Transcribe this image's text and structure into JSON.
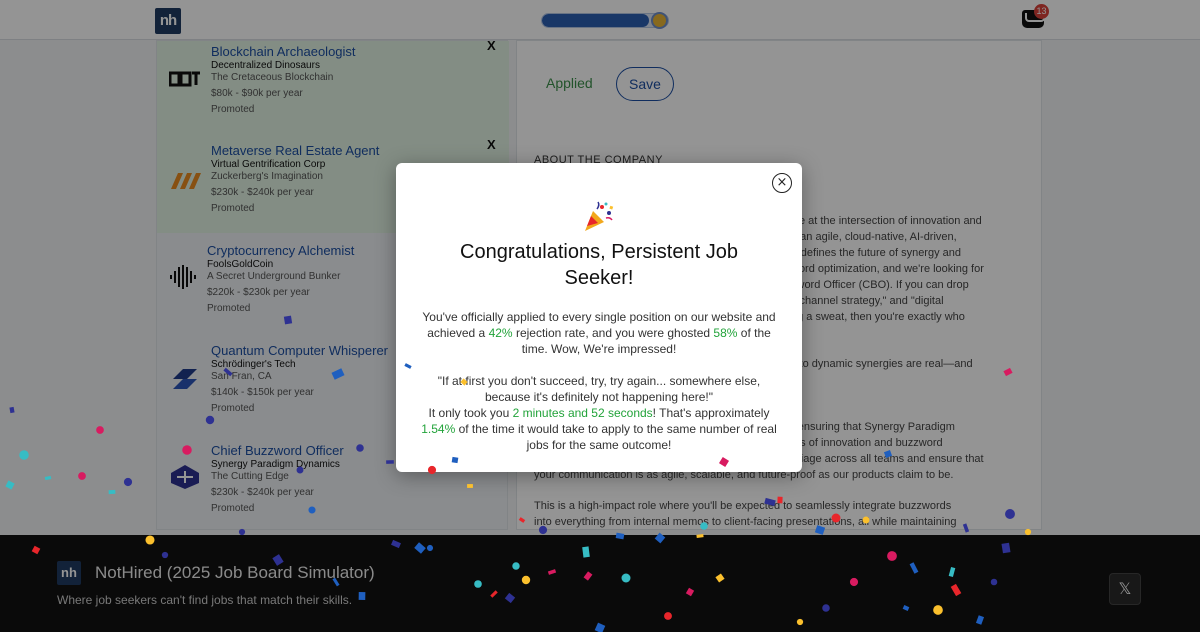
{
  "header": {
    "logo_text": "nh",
    "progress_fraction": 0.85,
    "inbox_count": "13"
  },
  "jobs": [
    {
      "title": "Blockchain Archaeologist",
      "company": "Decentralized Dinosaurs",
      "location": "The Cretaceous Blockchain",
      "salary": "$80k - $90k per year",
      "promo": "Promoted",
      "dismiss": "X"
    },
    {
      "title": "Metaverse Real Estate Agent",
      "company": "Virtual Gentrification Corp",
      "location": "Zuckerberg's Imagination",
      "salary": "$230k - $240k per year",
      "promo": "Promoted",
      "dismiss": "X"
    },
    {
      "title": "Cryptocurrency Alchemist",
      "company": "FoolsGoldCoin",
      "location": "A Secret Underground Bunker",
      "salary": "$220k - $230k per year",
      "promo": "Promoted"
    },
    {
      "title": "Quantum Computer Whisperer",
      "company": "Schrödinger's Tech",
      "location": "San Fran, CA",
      "salary": "$140k - $150k per year",
      "promo": "Promoted"
    },
    {
      "title": "Chief Buzzword Officer",
      "company": "Synergy Paradigm Dynamics",
      "location": "The Cutting Edge",
      "salary": "$230k - $240k per year",
      "promo": "Promoted"
    }
  ],
  "detail": {
    "applied_label": "Applied",
    "save_label": "Save",
    "about_heading": "ABOUT THE COMPANY",
    "paragraphs": [
      "ive at the intersection of innovation and",
      "e an agile, cloud-native, AI-driven,",
      "redefines the future of synergy and",
      "word optimization, and we're looking for",
      "zword Officer (CBO). If you can drop",
      "nichannel strategy,\" and \"digital",
      "ng a sweat, then you're exactly who",
      "into dynamic synergies are real—and",
      "r ensuring that Synergy Paradigm",
      "ms of innovation and buzzword",
      "rbiage across all teams and ensure that",
      "your communication is as agile, scalable, and future-proof as our products claim to be.",
      "This is a high-impact role where you'll be expected to seamlessly integrate buzzwords",
      "into everything from internal memos to client-facing presentations, all while maintaining"
    ]
  },
  "footer": {
    "logo_text": "nh",
    "title": "NotHired (2025 Job Board Simulator)",
    "tagline": "Where job seekers can't find jobs that match their skills.",
    "x_label": "𝕏"
  },
  "modal": {
    "close_label": "×",
    "title": "Congratulations, Persistent Job Seeker!",
    "p1_a": "You've officially applied to every single position on our website and achieved a ",
    "p1_rejection": "42%",
    "p1_b": " rejection rate, and you were ghosted ",
    "p1_ghosted": "58%",
    "p1_c": " of the time. Wow, We're impressed!",
    "quote": "\"If at first you don't succeed, try, try again... somewhere else, because it's definitely not happening here!\"",
    "p3_a": "It only took you ",
    "p3_time": "2 minutes and 52 seconds",
    "p3_b": "! That's approximately ",
    "p3_pct": "1.54%",
    "p3_c": " of the time it would take to apply to the same number of real jobs for the same outcome!"
  },
  "colors": {
    "brand": "#1f3b63",
    "accent_blue": "#1d4fa3",
    "success_green": "#22a33a",
    "confetti": [
      "#e8262b",
      "#fbc02d",
      "#2e3192",
      "#37bcc4",
      "#1f5fbf",
      "#d81b60"
    ]
  }
}
